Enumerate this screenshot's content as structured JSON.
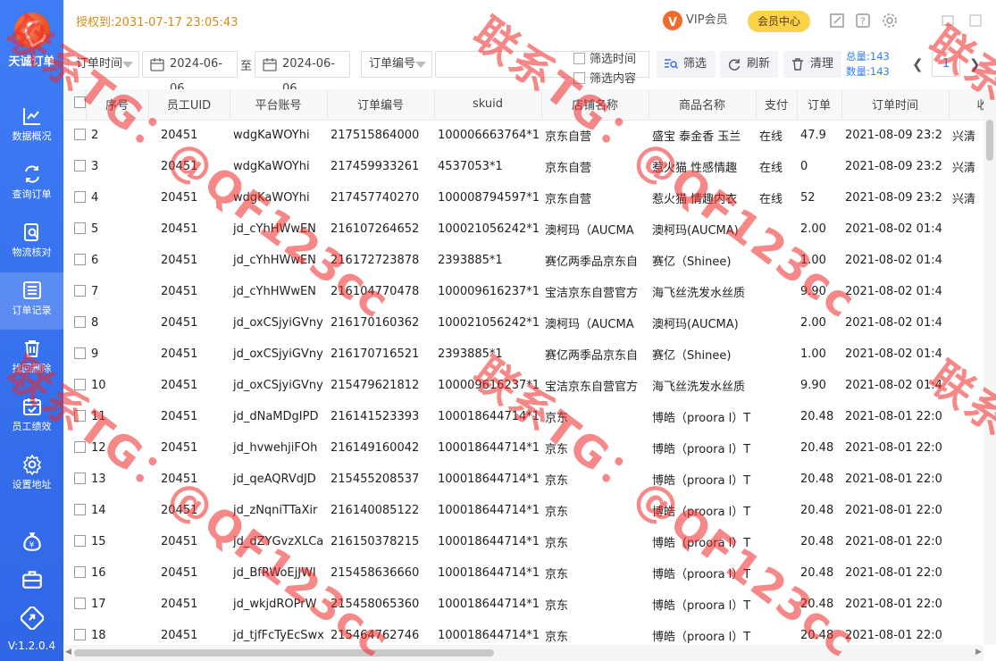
{
  "app": {
    "name": "天诚订单",
    "auth_text": "授权到:2031-07-17 23:05:43",
    "vip_label": "VIP会员",
    "member_center_label": "会员中心",
    "version": "V:1.2.0.4"
  },
  "sidebar": {
    "items": [
      {
        "label": "数据概况",
        "icon": "chart-icon"
      },
      {
        "label": "查询订单",
        "icon": "refresh-link-icon"
      },
      {
        "label": "物流核对",
        "icon": "doc-search-icon"
      },
      {
        "label": "订单记录",
        "icon": "list-icon",
        "active": true
      },
      {
        "label": "找回删除",
        "icon": "trash-icon"
      },
      {
        "label": "员工绩效",
        "icon": "calendar-check-icon"
      },
      {
        "label": "设置地址",
        "icon": "gear-icon"
      }
    ],
    "extra_icons": [
      "money-bag-icon",
      "briefcase-icon",
      "share-icon"
    ]
  },
  "toolbar": {
    "time_type": "订单时间",
    "date_start": "2024-06-06",
    "to_label": "至",
    "date_end": "2024-06-06",
    "field_type": "订单编号",
    "search_value": "",
    "filter_time_label": "筛选时间",
    "filter_content_label": "筛选内容",
    "filter_btn": "筛选",
    "refresh_btn": "刷新",
    "clear_btn": "清理",
    "total_label": "总量:143",
    "count_label": "数量:143",
    "page": "1"
  },
  "table": {
    "columns": [
      "序号",
      "员工UID",
      "平台账号",
      "订单编号",
      "skuid",
      "店铺名称",
      "商品名称",
      "支付",
      "订单",
      "订单时间",
      "收货"
    ],
    "rows": [
      [
        "2",
        "20451",
        "wdgKaWOYhi",
        "217515864000",
        "100006663764*1",
        "京东自营",
        "盛宝 泰金香 玉兰",
        "在线",
        "47.9",
        "2021-08-09 23:2",
        "兴清"
      ],
      [
        "3",
        "20451",
        "wdgKaWOYhi",
        "217459933261",
        "4537053*1",
        "京东自营",
        "惹火猫 性感情趣",
        "在线",
        "0",
        "2021-08-09 23:2",
        "兴清"
      ],
      [
        "4",
        "20451",
        "wdgKaWOYhi",
        "217457740270",
        "100008794597*1",
        "京东自营",
        "惹火猫 情趣内衣",
        "在线",
        "52",
        "2021-08-09 23:2",
        "兴清"
      ],
      [
        "5",
        "20451",
        "jd_cYhHWwEN",
        "216107264652",
        "100021056242*1",
        "澳柯玛（AUCMA",
        "澳柯玛(AUCMA)",
        "",
        "2.00",
        "2021-08-02 01:4",
        ""
      ],
      [
        "6",
        "20451",
        "jd_cYhHWwEN",
        "216172723878",
        "2393885*1",
        "赛亿两季品京东自",
        "赛亿（Shinee)",
        "",
        "1.00",
        "2021-08-02 01:4",
        ""
      ],
      [
        "7",
        "20451",
        "jd_cYhHWwEN",
        "216104770478",
        "100009616237*1",
        "宝洁京东自营官方",
        "海飞丝洗发水丝质",
        "",
        "9.90",
        "2021-08-02 01:4",
        ""
      ],
      [
        "8",
        "20451",
        "jd_oxCSjyiGVny",
        "216170160362",
        "100021056242*1",
        "澳柯玛（AUCMA",
        "澳柯玛(AUCMA)",
        "",
        "2.00",
        "2021-08-02 01:4",
        ""
      ],
      [
        "9",
        "20451",
        "jd_oxCSjyiGVny",
        "216170716521",
        "2393885*1",
        "赛亿两季品京东自",
        "赛亿（Shinee)",
        "",
        "1.00",
        "2021-08-02 01:4",
        ""
      ],
      [
        "10",
        "20451",
        "jd_oxCSjyiGVny",
        "215479621812",
        "100009616237*1",
        "宝洁京东自营官方",
        "海飞丝洗发水丝质",
        "",
        "9.90",
        "2021-08-02 01:4",
        ""
      ],
      [
        "11",
        "20451",
        "jd_dNaMDgIPD",
        "216141523393",
        "100018644714*1",
        "京东",
        "博皓（proora l）T",
        "",
        "20.48",
        "2021-08-01 22:0",
        ""
      ],
      [
        "12",
        "20451",
        "jd_hvwehjiFOh",
        "216149160042",
        "100018644714*1",
        "京东",
        "博皓（proora l）T",
        "",
        "20.48",
        "2021-08-01 22:0",
        ""
      ],
      [
        "13",
        "20451",
        "jd_qeAQRVdJD",
        "215455208537",
        "100018644714*1",
        "京东",
        "博皓（proora l）T",
        "",
        "20.48",
        "2021-08-01 22:0",
        ""
      ],
      [
        "14",
        "20451",
        "jd_zNqniTTaXir",
        "216140085122",
        "100018644714*1",
        "京东",
        "博皓（proora l）T",
        "",
        "20.48",
        "2021-08-01 22:0",
        ""
      ],
      [
        "15",
        "20451",
        "jd_dZYGvzXLCa",
        "216150378215",
        "100018644714*1",
        "京东",
        "博皓（proora l）T",
        "",
        "20.48",
        "2021-08-01 22:0",
        ""
      ],
      [
        "16",
        "20451",
        "jd_BfRWoEjJWI",
        "215458636660",
        "100018644714*1",
        "京东",
        "博皓（proora l）T",
        "",
        "20.48",
        "2021-08-01 22:0",
        ""
      ],
      [
        "17",
        "20451",
        "jd_wkjdROPrW",
        "215458065360",
        "100018644714*1",
        "京东",
        "博皓（proora l）T",
        "",
        "20.48",
        "2021-08-01 22:0",
        ""
      ],
      [
        "18",
        "20451",
        "jd_tjfFcTyEcSwx",
        "215464762746",
        "100018644714*1",
        "京东",
        "博皓（proora l）T",
        "",
        "20.48",
        "2021-08-01 22:0",
        ""
      ]
    ]
  },
  "watermarks": [
    "联系TG：@QF123cc",
    "联系TG：@QF123cc",
    "联系",
    "联系"
  ],
  "colors": {
    "sidebar": "#3f7df6",
    "accent": "#2f7bf6",
    "auth": "#d98b17",
    "member": "#fbd24a",
    "watermark": "#ee2626"
  }
}
